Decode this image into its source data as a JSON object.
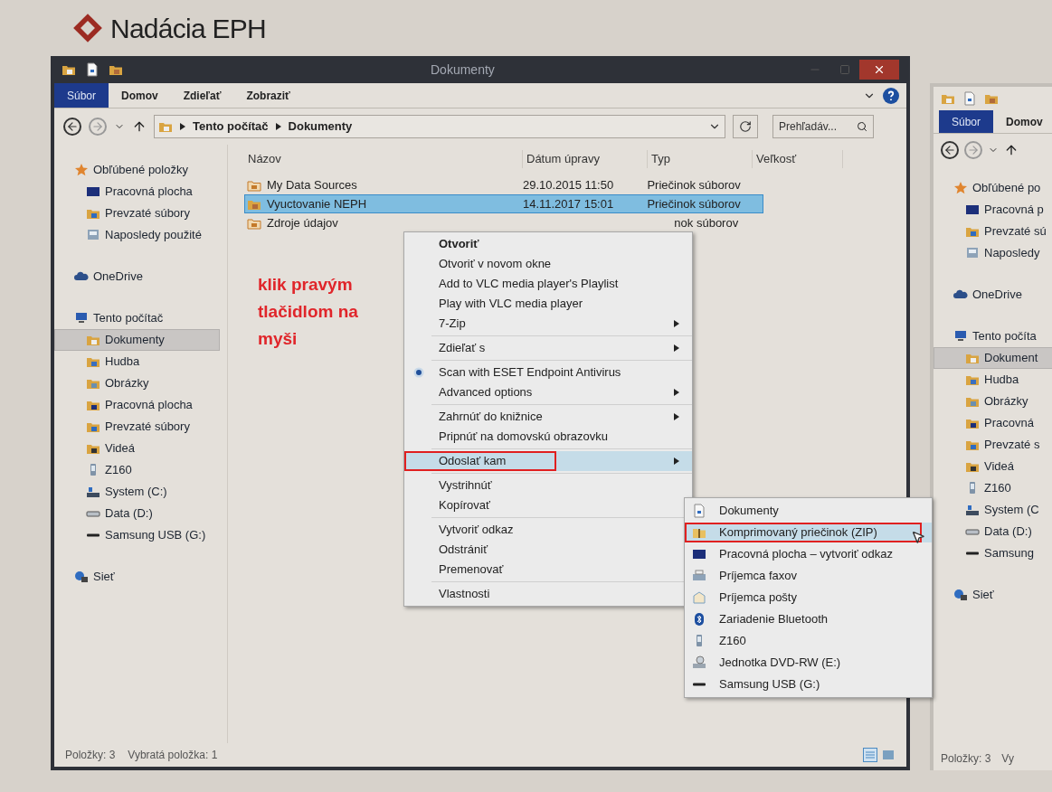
{
  "logo": {
    "text": "Nadácia EPH"
  },
  "window": {
    "title": "Dokumenty",
    "ribbon_tabs": [
      {
        "label": "Súbor",
        "selected": true
      },
      {
        "label": "Domov",
        "selected": false
      },
      {
        "label": "Zdieľať",
        "selected": false
      },
      {
        "label": "Zobraziť",
        "selected": false
      }
    ],
    "address": {
      "path": [
        "Tento počítač",
        "Dokumenty"
      ]
    },
    "search": {
      "placeholder": "Prehľadáv..."
    },
    "sidebar": {
      "sections": [
        {
          "label": "Obľúbené položky",
          "kind": "star",
          "children": [
            {
              "label": "Pracovná plocha",
              "kind": "desktop",
              "selected": false
            },
            {
              "label": "Prevzaté súbory",
              "kind": "downloads",
              "selected": false
            },
            {
              "label": "Naposledy použité",
              "kind": "recent",
              "selected": false
            }
          ]
        },
        {
          "label": "OneDrive",
          "kind": "cloud"
        },
        {
          "label": "Tento počítač",
          "kind": "computer",
          "children": [
            {
              "label": "Dokumenty",
              "kind": "documents",
              "selected": true
            },
            {
              "label": "Hudba",
              "kind": "music",
              "selected": false
            },
            {
              "label": "Obrázky",
              "kind": "pictures",
              "selected": false
            },
            {
              "label": "Pracovná plocha",
              "kind": "desktop-folder",
              "selected": false
            },
            {
              "label": "Prevzaté súbory",
              "kind": "downloads",
              "selected": false
            },
            {
              "label": "Videá",
              "kind": "video",
              "selected": false
            },
            {
              "label": "Z160",
              "kind": "phone",
              "selected": false
            },
            {
              "label": "System (C:)",
              "kind": "system-drive",
              "selected": false
            },
            {
              "label": "Data (D:)",
              "kind": "drive",
              "selected": false
            },
            {
              "label": "Samsung USB (G:)",
              "kind": "usb",
              "selected": false
            }
          ]
        },
        {
          "label": "Sieť",
          "kind": "network"
        }
      ]
    },
    "table": {
      "columns": [
        "Názov",
        "Dátum úpravy",
        "Typ",
        "Veľkosť"
      ],
      "rows": [
        {
          "name": "My Data Sources",
          "date": "29.10.2015 11:50",
          "type": "Priečinok súborov",
          "kind": "shared-folder",
          "selected": false
        },
        {
          "name": "Vyuctovanie NEPH",
          "date": "14.11.2017 15:01",
          "type": "Priečinok súborov",
          "kind": "folder",
          "selected": true
        },
        {
          "name": "Zdroje údajov",
          "type": "nok súborov",
          "kind": "shared-folder",
          "selected": false
        }
      ]
    },
    "status_bar": {
      "items": "Položky: 3",
      "selection": "Vybratá položka: 1"
    }
  },
  "annotation": {
    "text": "klik pravým tlačidlom na myši"
  },
  "context_menu": {
    "groups": [
      [
        {
          "label": "Otvoriť",
          "bold": true,
          "submenu": false,
          "eset": false,
          "selected": false,
          "marked": false
        },
        {
          "label": "Otvoriť v novom okne",
          "bold": false,
          "submenu": false,
          "eset": false,
          "selected": false,
          "marked": false
        },
        {
          "label": "Add to VLC media player's Playlist",
          "bold": false,
          "submenu": false,
          "eset": false,
          "selected": false,
          "marked": false
        },
        {
          "label": "Play with VLC media player",
          "bold": false,
          "submenu": false,
          "eset": false,
          "selected": false,
          "marked": false
        },
        {
          "label": "7-Zip",
          "bold": false,
          "submenu": true,
          "eset": false,
          "selected": false,
          "marked": false
        }
      ],
      [
        {
          "label": "Zdieľať s",
          "bold": false,
          "submenu": true,
          "eset": false,
          "selected": false,
          "marked": false
        }
      ],
      [
        {
          "label": "Scan with ESET Endpoint Antivirus",
          "bold": false,
          "submenu": false,
          "eset": true,
          "selected": false,
          "marked": false
        },
        {
          "label": "Advanced options",
          "bold": false,
          "submenu": true,
          "eset": false,
          "selected": false,
          "marked": false
        }
      ],
      [
        {
          "label": "Zahrnúť do knižnice",
          "bold": false,
          "submenu": true,
          "eset": false,
          "selected": false,
          "marked": false
        },
        {
          "label": "Pripnúť na domovskú obrazovku",
          "bold": false,
          "submenu": false,
          "eset": false,
          "selected": false,
          "marked": false
        }
      ],
      [
        {
          "label": "Odoslať kam",
          "bold": false,
          "submenu": true,
          "eset": false,
          "selected": true,
          "marked": true
        }
      ],
      [
        {
          "label": "Vystrihnúť",
          "bold": false,
          "submenu": false,
          "eset": false,
          "selected": false,
          "marked": false
        },
        {
          "label": "Kopírovať",
          "bold": false,
          "submenu": false,
          "eset": false,
          "selected": false,
          "marked": false
        }
      ],
      [
        {
          "label": "Vytvoriť odkaz",
          "bold": false,
          "submenu": false,
          "eset": false,
          "selected": false,
          "marked": false
        },
        {
          "label": "Odstrániť",
          "bold": false,
          "submenu": false,
          "eset": false,
          "selected": false,
          "marked": false
        },
        {
          "label": "Premenovať",
          "bold": false,
          "submenu": false,
          "eset": false,
          "selected": false,
          "marked": false
        }
      ],
      [
        {
          "label": "Vlastnosti",
          "bold": false,
          "submenu": false,
          "eset": false,
          "selected": false,
          "marked": false
        }
      ]
    ]
  },
  "send_to_menu": {
    "items": [
      {
        "label": "Dokumenty",
        "kind": "document",
        "selected": false,
        "marked": false
      },
      {
        "label": "Komprimovaný priečinok (ZIP)",
        "kind": "zip",
        "selected": true,
        "marked": true
      },
      {
        "label": "Pracovná plocha – vytvoriť odkaz",
        "kind": "desktop",
        "selected": false,
        "marked": false
      },
      {
        "label": "Príjemca faxov",
        "kind": "fax",
        "selected": false,
        "marked": false
      },
      {
        "label": "Príjemca pošty",
        "kind": "mail",
        "selected": false,
        "marked": false
      },
      {
        "label": "Zariadenie Bluetooth",
        "kind": "bluetooth",
        "selected": false,
        "marked": false
      },
      {
        "label": "Z160",
        "kind": "phone",
        "selected": false,
        "marked": false
      },
      {
        "label": "Jednotka DVD-RW (E:)",
        "kind": "dvd",
        "selected": false,
        "marked": false
      },
      {
        "label": "Samsung USB (G:)",
        "kind": "usb",
        "selected": false,
        "marked": false
      }
    ]
  },
  "second_window": {
    "ribbon_tabs": [
      {
        "label": "Súbor",
        "selected": true
      },
      {
        "label": "Domov",
        "selected": false
      }
    ],
    "sidebar": {
      "sections": [
        {
          "label": "Obľúbené po",
          "kind": "star",
          "children": [
            {
              "label": "Pracovná p",
              "kind": "desktop",
              "selected": false
            },
            {
              "label": "Prevzaté sú",
              "kind": "downloads",
              "selected": false
            },
            {
              "label": "Naposledy",
              "kind": "recent",
              "selected": false
            }
          ]
        },
        {
          "label": "OneDrive",
          "kind": "cloud"
        },
        {
          "label": "Tento počíta",
          "kind": "computer",
          "children": [
            {
              "label": "Dokument",
              "kind": "documents",
              "selected": true
            },
            {
              "label": "Hudba",
              "kind": "music",
              "selected": false
            },
            {
              "label": "Obrázky",
              "kind": "pictures",
              "selected": false
            },
            {
              "label": "Pracovná",
              "kind": "desktop-folder",
              "selected": false
            },
            {
              "label": "Prevzaté s",
              "kind": "downloads",
              "selected": false
            },
            {
              "label": "Videá",
              "kind": "video",
              "selected": false
            },
            {
              "label": "Z160",
              "kind": "phone",
              "selected": false
            },
            {
              "label": "System (C",
              "kind": "system-drive",
              "selected": false
            },
            {
              "label": "Data (D:)",
              "kind": "drive",
              "selected": false
            },
            {
              "label": "Samsung",
              "kind": "usb",
              "selected": false
            }
          ]
        },
        {
          "label": "Sieť",
          "kind": "network"
        }
      ]
    },
    "status_bar": {
      "items": "Položky: 3",
      "selection": "Vy"
    }
  }
}
